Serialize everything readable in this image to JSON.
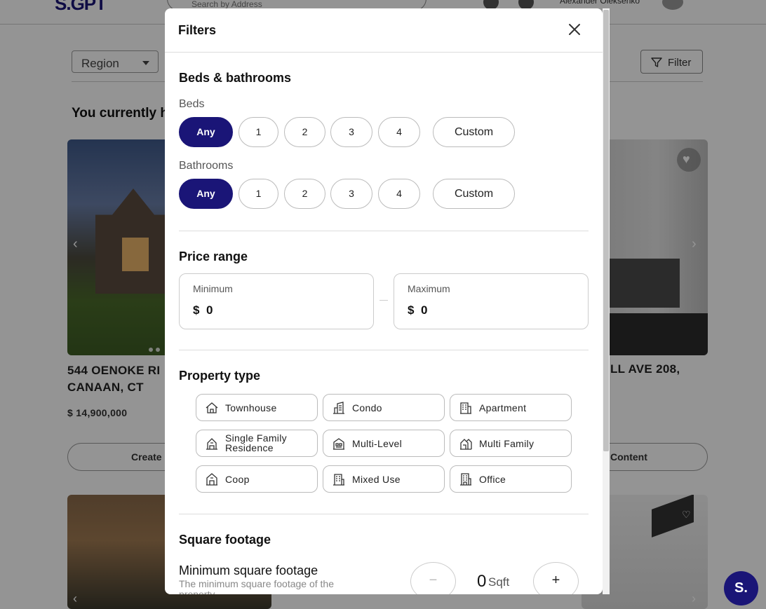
{
  "background": {
    "logo": "S.GPT",
    "search_placeholder": "Search by Address",
    "user_name": "Alexander Oleksenko",
    "region_label": "Region",
    "filter_label": "Filter",
    "heading": "You currently h",
    "listing1": {
      "address": "544 OENOKE RI CANAAN, CT",
      "price": "$ 14,900,000",
      "button": "Create"
    },
    "listing2": {
      "address": "LL AVE 208,",
      "button": "Content"
    },
    "fab_label": "S."
  },
  "modal": {
    "title": "Filters",
    "beds_baths": {
      "title": "Beds & bathrooms",
      "beds_label": "Beds",
      "baths_label": "Bathrooms",
      "options": [
        "Any",
        "1",
        "2",
        "3",
        "4"
      ],
      "custom_label": "Custom",
      "beds_selected": "Any",
      "baths_selected": "Any"
    },
    "price_range": {
      "title": "Price range",
      "min_label": "Minimum",
      "max_label": "Maximum",
      "currency": "$",
      "min_value": "0",
      "max_value": "0"
    },
    "property_type": {
      "title": "Property type",
      "items": [
        {
          "label": "Townhouse",
          "icon": "house-icon"
        },
        {
          "label": "Condo",
          "icon": "building-icon"
        },
        {
          "label": "Apartment",
          "icon": "apartment-icon"
        },
        {
          "label": "Single Family Residence",
          "icon": "residence-icon"
        },
        {
          "label": "Multi-Level",
          "icon": "multi-level-icon"
        },
        {
          "label": "Multi Family",
          "icon": "multi-family-icon"
        },
        {
          "label": "Coop",
          "icon": "coop-icon"
        },
        {
          "label": "Mixed Use",
          "icon": "mixed-use-icon"
        },
        {
          "label": "Office",
          "icon": "office-icon"
        }
      ]
    },
    "square_footage": {
      "title": "Square footage",
      "min_title": "Minimum square footage",
      "min_desc": "The minimum square footage of the property",
      "value": "0",
      "unit": "Sqft",
      "minus": "−",
      "plus": "+"
    }
  },
  "colors": {
    "accent": "#1a1577",
    "border": "#bbbbbb",
    "overlay": "rgba(0,0,0,0.42)"
  }
}
